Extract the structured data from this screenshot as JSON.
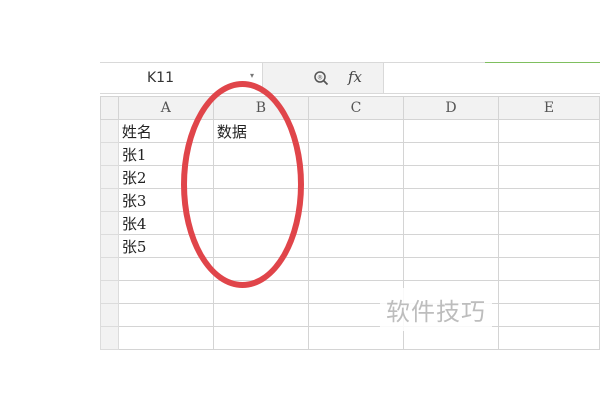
{
  "formula_bar": {
    "cell_ref": "K11",
    "dropdown_glyph": "▾",
    "fx_label": "fx",
    "formula_value": ""
  },
  "columns": [
    "A",
    "B",
    "C",
    "D",
    "E"
  ],
  "rows": [
    [
      "姓名",
      "数据",
      "",
      "",
      ""
    ],
    [
      "张1",
      "",
      "",
      "",
      ""
    ],
    [
      "张2",
      "",
      "",
      "",
      ""
    ],
    [
      "张3",
      "",
      "",
      "",
      ""
    ],
    [
      "张4",
      "",
      "",
      "",
      ""
    ],
    [
      "张5",
      "",
      "",
      "",
      ""
    ],
    [
      "",
      "",
      "",
      "",
      ""
    ],
    [
      "",
      "",
      "",
      "",
      ""
    ],
    [
      "",
      "",
      "",
      "",
      ""
    ],
    [
      "",
      "",
      "",
      "",
      ""
    ]
  ],
  "annotation_color": "#e0454a",
  "watermark": "软件技巧"
}
